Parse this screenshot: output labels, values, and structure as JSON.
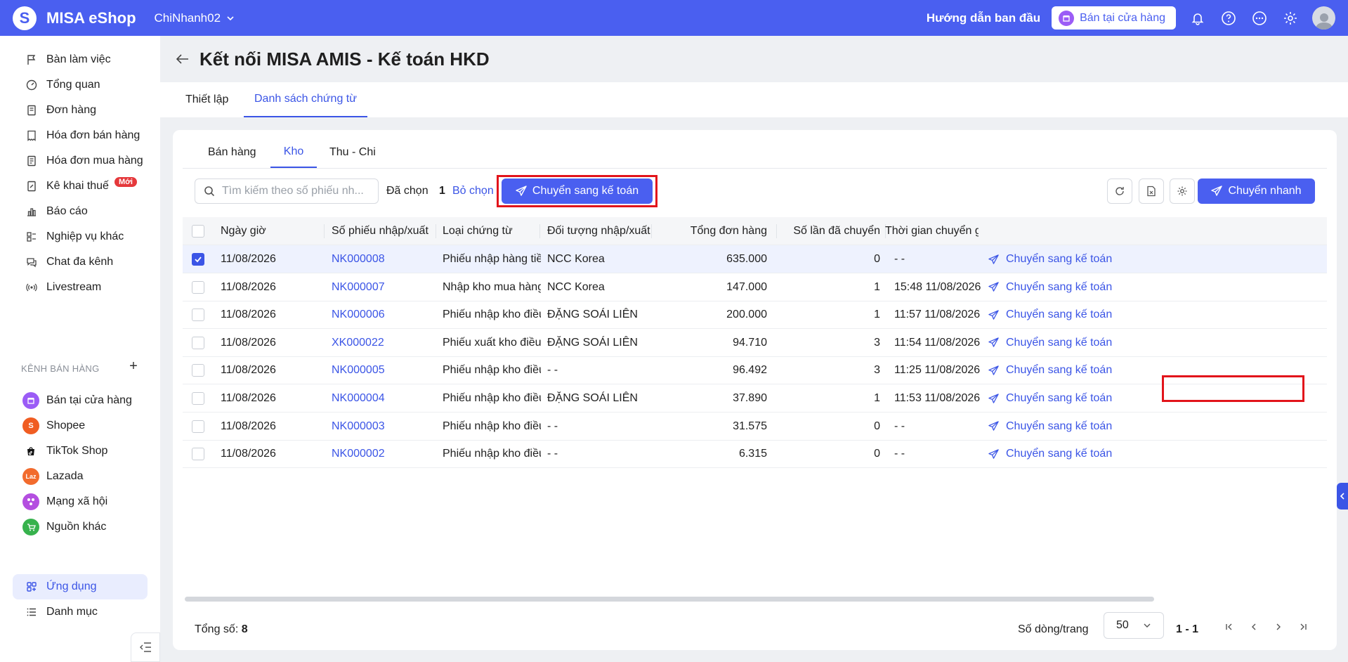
{
  "app": {
    "name": "MISA eShop",
    "branch": "ChiNhanh02",
    "guide": "Hướng dẫn ban đầu",
    "store_button": "Bán tại cửa hàng",
    "brand_color": "#4a5ff0"
  },
  "sidebar": {
    "items": [
      {
        "label": "Bàn làm việc",
        "icon": "flag-icon"
      },
      {
        "label": "Tổng quan",
        "icon": "dashboard-gauge-icon"
      },
      {
        "label": "Đơn hàng",
        "icon": "order-icon"
      },
      {
        "label": "Hóa đơn bán hàng",
        "icon": "sales-invoice-icon"
      },
      {
        "label": "Hóa đơn mua hàng",
        "icon": "purchase-invoice-icon"
      },
      {
        "label": "Kê khai thuế",
        "icon": "tax-icon",
        "badge": "Mới"
      },
      {
        "label": "Báo cáo",
        "icon": "report-icon"
      },
      {
        "label": "Nghiệp vụ khác",
        "icon": "other-operations-icon"
      },
      {
        "label": "Chat đa kênh",
        "icon": "chat-icon"
      },
      {
        "label": "Livestream",
        "icon": "livestream-icon"
      }
    ],
    "section_label": "KÊNH BÁN HÀNG",
    "channels": [
      {
        "label": "Bán tại cửa hàng",
        "icon": "store-icon",
        "color": "#9b5cf6"
      },
      {
        "label": "Shopee",
        "icon": "shopee-icon",
        "color": "#f05d22"
      },
      {
        "label": "TikTok Shop",
        "icon": "tiktok-icon",
        "color": "#111111"
      },
      {
        "label": "Lazada",
        "icon": "lazada-icon",
        "color": "#f26b2d"
      },
      {
        "label": "Mạng xã hội",
        "icon": "social-network-icon",
        "color": "#b44fe0"
      },
      {
        "label": "Nguồn khác",
        "icon": "other-source-icon",
        "color": "#37b24d"
      }
    ],
    "bottom_items": [
      {
        "label": "Ứng dụng",
        "icon": "apps-icon",
        "active": true
      },
      {
        "label": "Danh mục",
        "icon": "list-icon"
      }
    ]
  },
  "page": {
    "title": "Kết nối MISA AMIS - Kế toán HKD",
    "tabs": [
      "Thiết lập",
      "Danh sách chứng từ"
    ],
    "active_tab": "Danh sách chứng từ"
  },
  "card": {
    "subtabs": [
      "Bán hàng",
      "Kho",
      "Thu - Chi"
    ],
    "active_subtab": "Kho",
    "search_placeholder": "Tìm kiếm theo số phiếu nh...",
    "selected_label": "Đã chọn",
    "selected_count": "1",
    "unselect_label": "Bỏ chọn",
    "transfer_label": "Chuyển sang kế toán",
    "quick_label": "Chuyển nhanh"
  },
  "table": {
    "columns": [
      "Ngày giờ",
      "Số phiếu nhập/xuất",
      "Loại chứng từ",
      "Đối tượng nhập/xuất",
      "Tổng đơn hàng",
      "Số lần đã chuyển",
      "Thời gian chuyển gầ"
    ],
    "action_label": "Chuyển sang kế toán",
    "rows": [
      {
        "date": "11/08/2026",
        "code": "NK000008",
        "type": "Phiếu nhập hàng tiề...",
        "party": "NCC Korea",
        "total": "635.000",
        "count": "0",
        "time": "- -",
        "checked": true
      },
      {
        "date": "11/08/2026",
        "code": "NK000007",
        "type": "Nhập kho mua hàng",
        "party": "NCC Korea",
        "total": "147.000",
        "count": "1",
        "time": "15:48 11/08/2026",
        "checked": false
      },
      {
        "date": "11/08/2026",
        "code": "NK000006",
        "type": "Phiếu nhập kho điều...",
        "party": "ĐẶNG SOÁI LIÊN",
        "total": "200.000",
        "count": "1",
        "time": "11:57 11/08/2026",
        "checked": false
      },
      {
        "date": "11/08/2026",
        "code": "XK000022",
        "type": "Phiếu xuất kho điều ...",
        "party": "ĐẶNG SOÁI LIÊN",
        "total": "94.710",
        "count": "3",
        "time": "11:54 11/08/2026",
        "checked": false
      },
      {
        "date": "11/08/2026",
        "code": "NK000005",
        "type": "Phiếu nhập kho điều...",
        "party": "- -",
        "total": "96.492",
        "count": "3",
        "time": "11:25 11/08/2026",
        "checked": false
      },
      {
        "date": "11/08/2026",
        "code": "NK000004",
        "type": "Phiếu nhập kho điều...",
        "party": "ĐẶNG SOÁI LIÊN",
        "total": "37.890",
        "count": "1",
        "time": "11:53 11/08/2026",
        "checked": false
      },
      {
        "date": "11/08/2026",
        "code": "NK000003",
        "type": "Phiếu nhập kho điều...",
        "party": "- -",
        "total": "31.575",
        "count": "0",
        "time": "- -",
        "checked": false
      },
      {
        "date": "11/08/2026",
        "code": "NK000002",
        "type": "Phiếu nhập kho điều...",
        "party": "- -",
        "total": "6.315",
        "count": "0",
        "time": "- -",
        "checked": false
      }
    ]
  },
  "footer": {
    "total_label": "Tổng số:",
    "total_value": "8",
    "rows_label": "Số dòng/trang",
    "rows_value": "50",
    "range": "1 - 1"
  }
}
